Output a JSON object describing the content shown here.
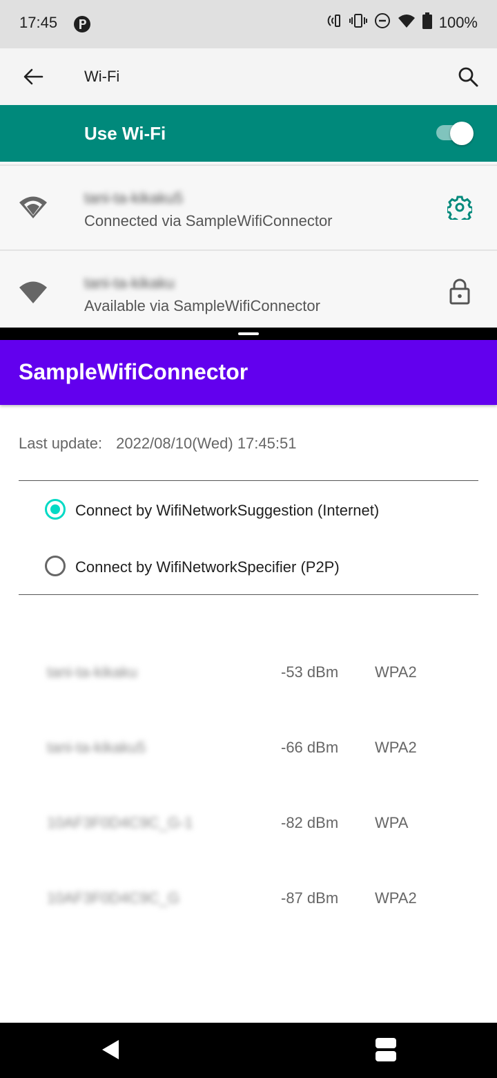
{
  "status_bar": {
    "time": "17:45",
    "battery": "100%",
    "icons": [
      "app-notification-icon",
      "nfc-icon",
      "vibrate-icon",
      "dnd-icon",
      "wifi-icon",
      "battery-icon"
    ]
  },
  "settings": {
    "title": "Wi-Fi",
    "use_wifi_label": "Use Wi-Fi",
    "use_wifi_on": true,
    "accent_color": "#00897b",
    "networks": [
      {
        "ssid": "tani-ta-kikaku5",
        "subtitle": "Connected via SampleWifiConnector",
        "trailing_icon": "gear-icon"
      },
      {
        "ssid": "tani-ta-kikaku",
        "subtitle": "Available via SampleWifiConnector",
        "trailing_icon": "lock-icon"
      }
    ]
  },
  "app": {
    "title": "SampleWifiConnector",
    "brand_color": "#6200ee",
    "last_update_label": "Last update:",
    "last_update_value": "2022/08/10(Wed) 17:45:51",
    "options": [
      {
        "label": "Connect by WifiNetworkSuggestion (Internet)",
        "selected": true
      },
      {
        "label": "Connect by WifiNetworkSpecifier (P2P)",
        "selected": false
      }
    ],
    "scan_results": [
      {
        "ssid": "tani-ta-kikaku",
        "rssi": "-53 dBm",
        "security": "WPA2"
      },
      {
        "ssid": "tani-ta-kikaku5",
        "rssi": "-66 dBm",
        "security": "WPA2"
      },
      {
        "ssid": "10AF3F0D4C9C_G-1",
        "rssi": "-82 dBm",
        "security": "WPA"
      },
      {
        "ssid": "10AF3F0D4C9C_G",
        "rssi": "-87 dBm",
        "security": "WPA2"
      }
    ]
  }
}
